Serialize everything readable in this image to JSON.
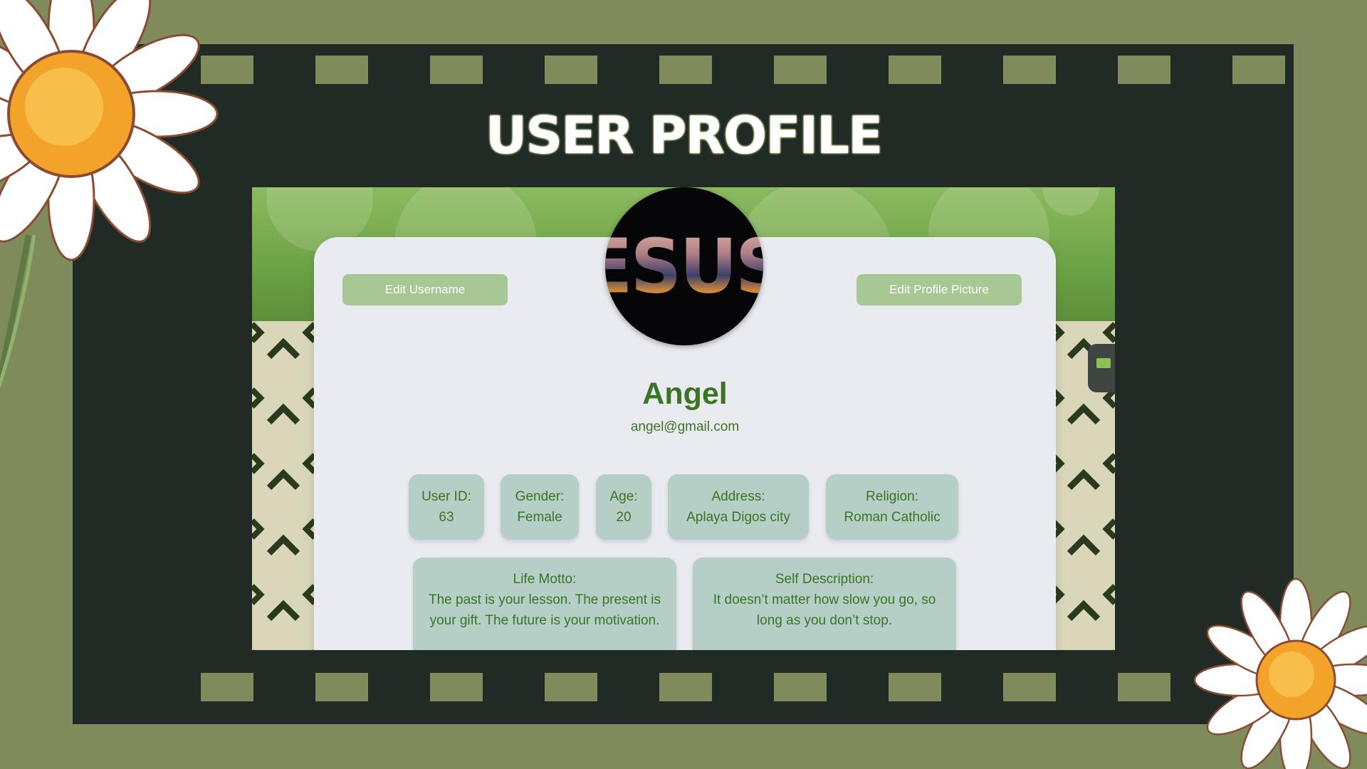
{
  "page": {
    "title": "USER PROFILE"
  },
  "profile_actions": {
    "edit_username": "Edit Username",
    "edit_profile_picture": "Edit Profile Picture"
  },
  "avatar": {
    "text": "ESUS"
  },
  "user": {
    "name": "Angel",
    "email": "angel@gmail.com"
  },
  "info_fields": [
    {
      "label": "User ID:",
      "value": "63"
    },
    {
      "label": "Gender:",
      "value": "Female"
    },
    {
      "label": "Age:",
      "value": "20"
    },
    {
      "label": "Address:",
      "value": "Aplaya Digos city"
    },
    {
      "label": "Religion:",
      "value": "Roman Catholic"
    }
  ],
  "life_motto": {
    "label": "Life Motto:",
    "value": "The past is your lesson. The present is your gift. The future is your motivation."
  },
  "self_description": {
    "label": "Self Description:",
    "value": "It doesn’t matter how slow you go, so long as you don’t stop."
  },
  "icons": [
    "daisy-flower-icon",
    "chat-widget-icon"
  ],
  "colors": {
    "background": "#7f8b5b",
    "frame": "#1f2b24",
    "accent_green": "#3b7423",
    "button": "#a7c794",
    "info_box": "#b5cfc6"
  }
}
